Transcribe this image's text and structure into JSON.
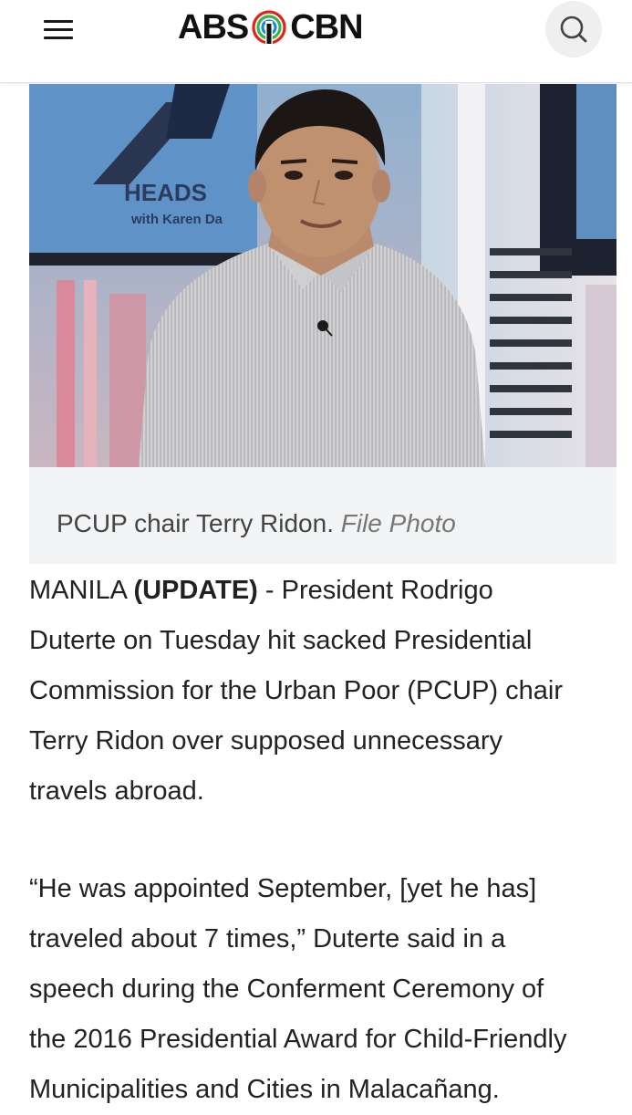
{
  "header": {
    "logo_left": "ABS",
    "logo_right": "CBN",
    "menu_icon": "hamburger-menu-icon",
    "search_icon": "search-icon"
  },
  "photo": {
    "backdrop_text_1": "HEADS",
    "backdrop_text_2": "with Karen Da"
  },
  "caption": {
    "text": "PCUP chair Terry Ridon.",
    "credit": "File Photo"
  },
  "article": {
    "p1": {
      "lead": "MANILA ",
      "tag": "(UPDATE)",
      "lines": [
        " - President Rodrigo",
        "Duterte on Tuesday hit sacked Presidential",
        "Commission for the Urban Poor (PCUP) chair",
        "Terry Ridon over supposed unnecessary",
        "travels abroad."
      ]
    },
    "p2": {
      "lines": [
        "“He was appointed September, [yet he has]",
        "traveled about 7 times,” Duterte said in a",
        "speech during the Conferment Ceremony of",
        "the 2016 Presidential Award for Child-Friendly",
        "Municipalities and Cities in Malacañang."
      ]
    }
  },
  "colors": {
    "logo_text": "#111111",
    "logo_red": "#e2231a",
    "logo_green": "#3ab54a",
    "logo_blue": "#1e88e5",
    "caption_bg": "#f2f4f6"
  }
}
